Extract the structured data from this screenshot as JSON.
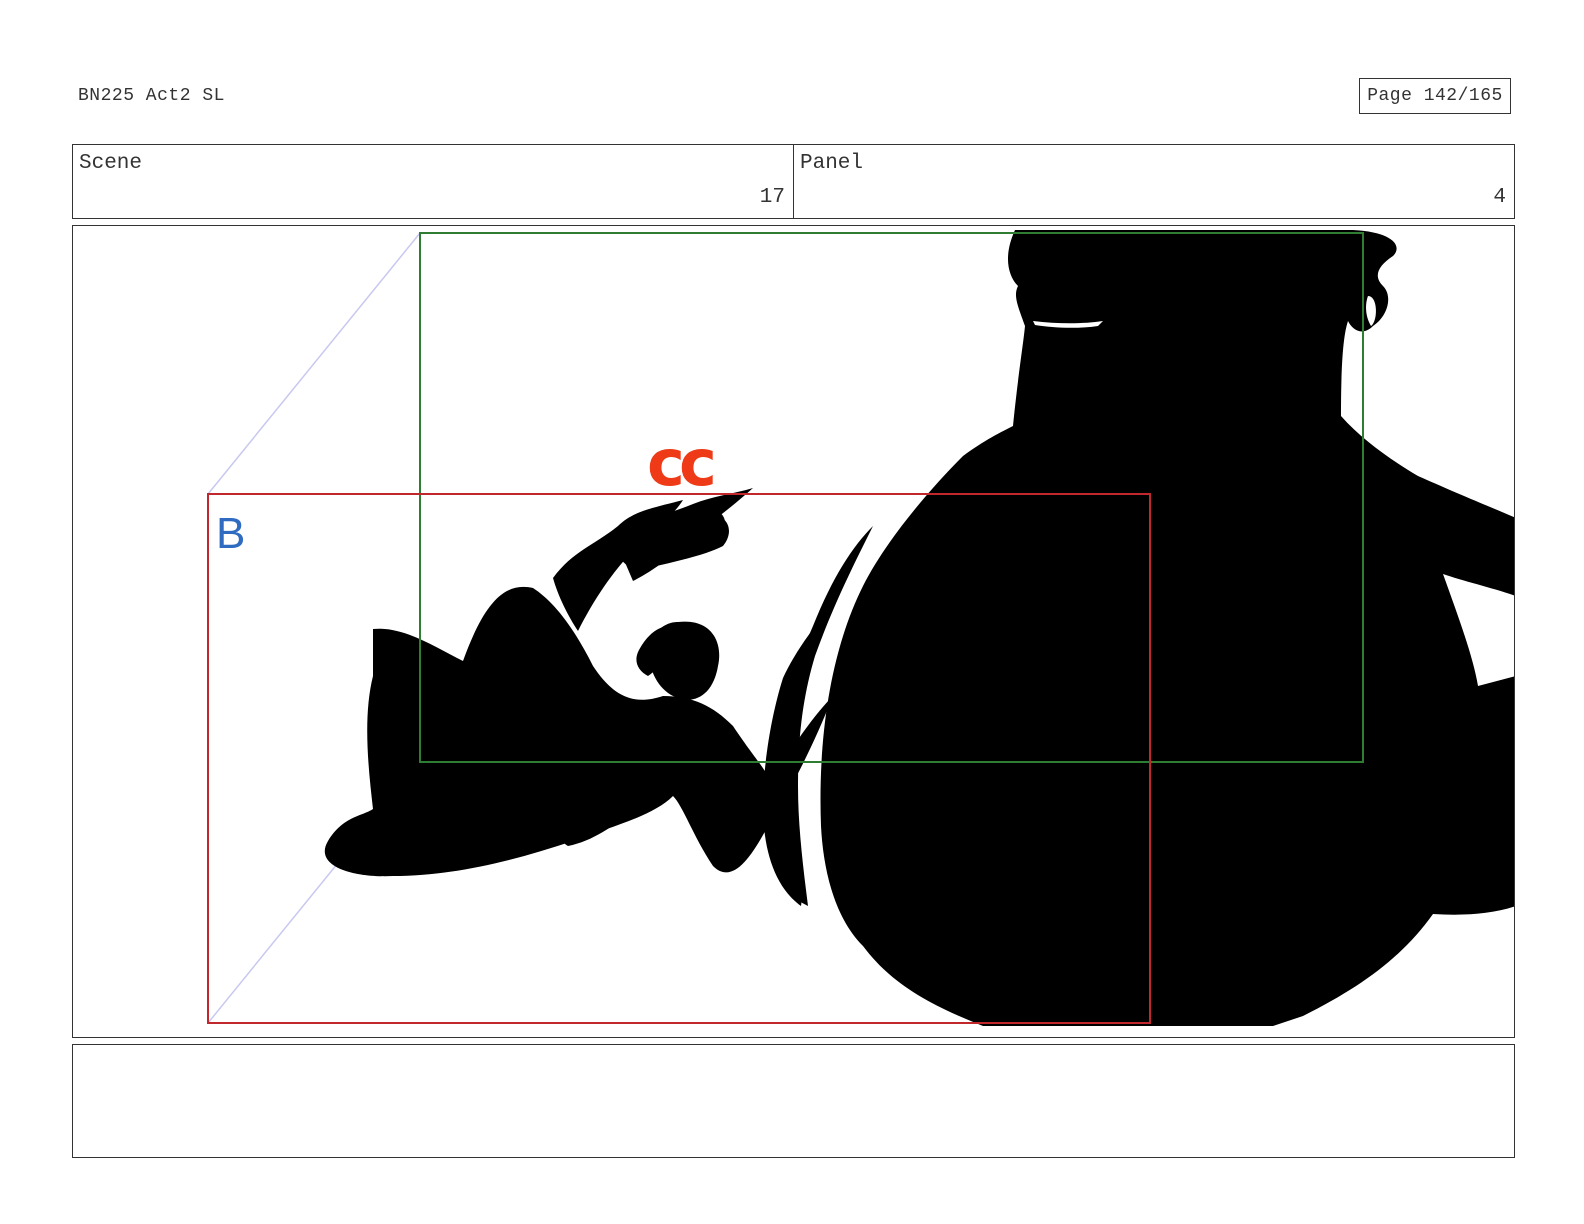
{
  "document": {
    "title": "BN225 Act2 SL",
    "page": "Page 142/165"
  },
  "header": {
    "scene_label": "Scene",
    "scene_value": "17",
    "panel_label": "Panel",
    "panel_value": "4"
  },
  "panel": {
    "sfx_text": "cc",
    "frame_tag": "B",
    "colors": {
      "silhouette": "#000000",
      "frame_b": "#c0282d",
      "frame_a": "#2e7d32",
      "sfx": "#ee3a16",
      "tag": "#2f6bc0",
      "guide": "#c8c8f0"
    }
  },
  "caption": {
    "text": ""
  }
}
